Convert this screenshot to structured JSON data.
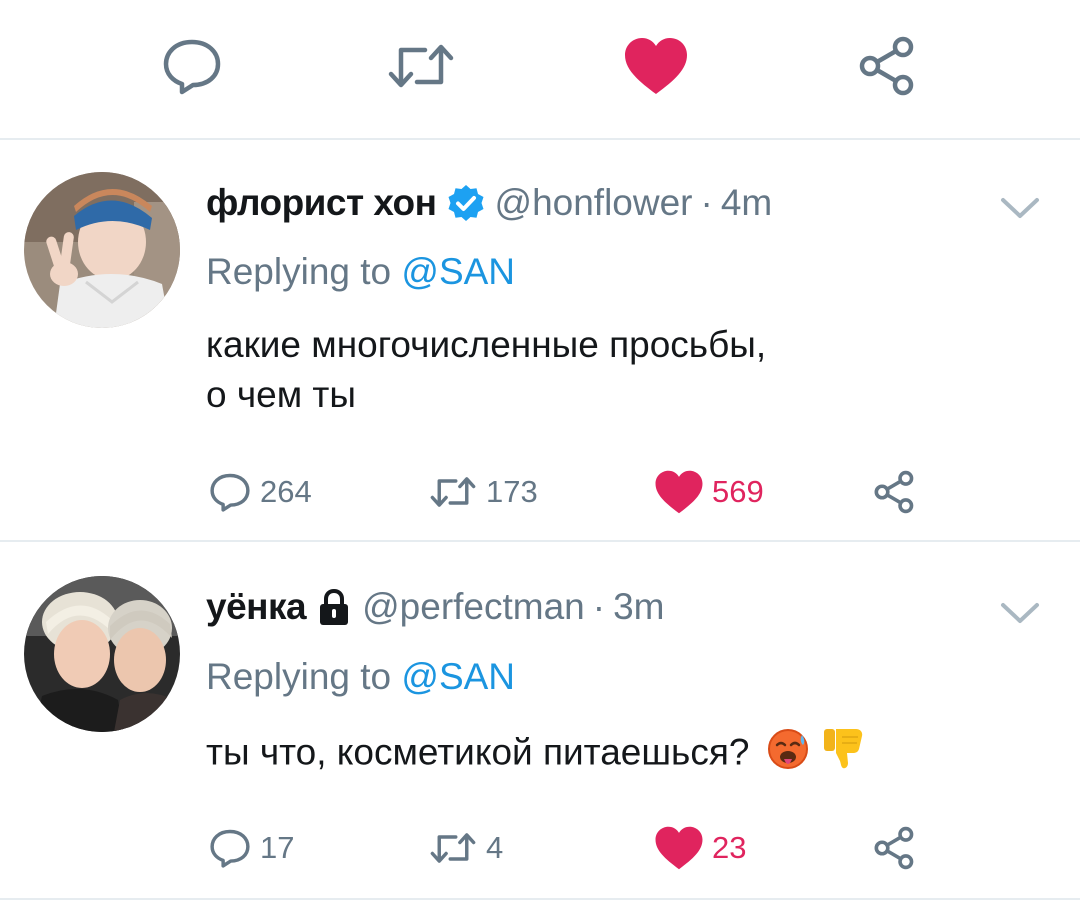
{
  "top_actions": {
    "reply_icon": "reply-icon",
    "retweet_icon": "retweet-icon",
    "like_icon": "heart-filled-icon",
    "share_icon": "share-icon",
    "like_color": "#e0245e"
  },
  "colors": {
    "text": "#14171a",
    "muted": "#657786",
    "link": "#1b95e0",
    "like": "#e0245e",
    "divider": "#e6ecf0"
  },
  "tweets": [
    {
      "display_name": "флорист хон",
      "verified": true,
      "handle": "@honflower",
      "separator": "·",
      "time": "4m",
      "replying_prefix": "Replying to",
      "replying_to": "@SAN",
      "text_line1": "какие многочисленные просьбы,",
      "text_line2": "о чем ты",
      "stats": {
        "replies": "264",
        "retweets": "173",
        "likes": "569",
        "liked": true
      }
    },
    {
      "display_name": "уёнка",
      "locked": true,
      "handle": "@perfectman",
      "separator": "·",
      "time": "3m",
      "replying_prefix": "Replying to",
      "replying_to": "@SAN",
      "text_line1": "ты что, косметикой питаешься?",
      "emojis": [
        "hot-face-emoji",
        "thumbs-down-emoji"
      ],
      "stats": {
        "replies": "17",
        "retweets": "4",
        "likes": "23",
        "liked": true
      }
    }
  ]
}
